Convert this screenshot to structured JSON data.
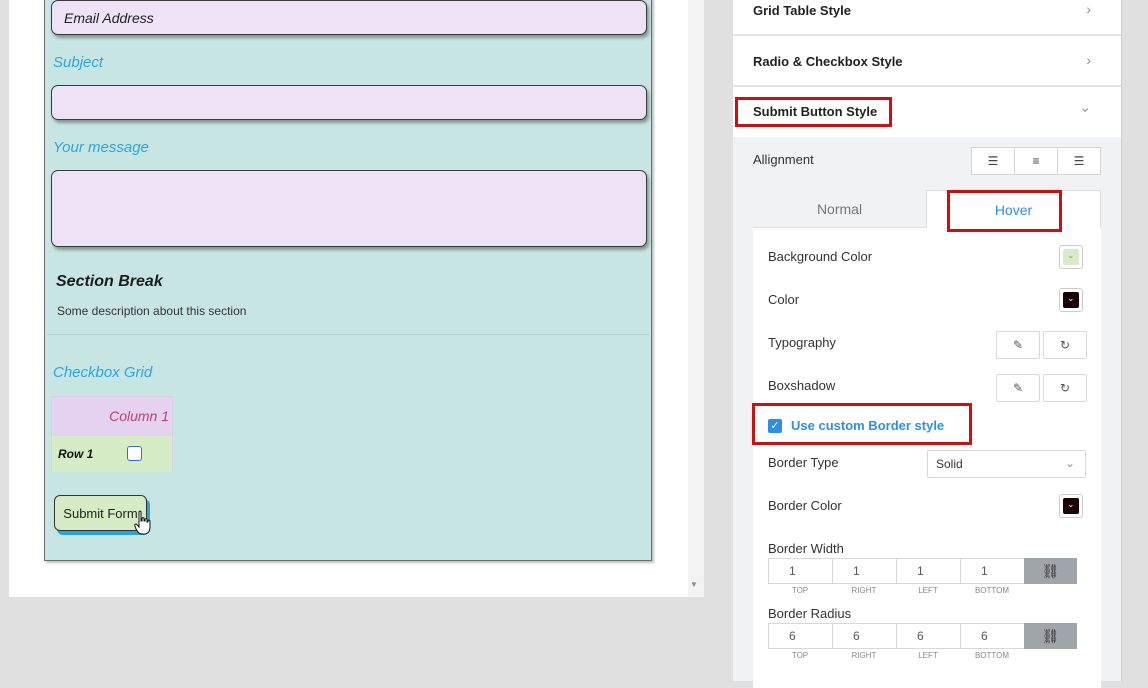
{
  "form": {
    "email_placeholder": "Email Address",
    "subject_label": "Subject",
    "message_label": "Your message",
    "section_title": "Section Break",
    "section_desc": "Some description about this section",
    "grid_label": "Checkbox Grid",
    "grid_column": "Column 1",
    "grid_row": "Row 1",
    "submit_label": "Submit Form"
  },
  "panel": {
    "sections": [
      {
        "label": "Grid Table Style"
      },
      {
        "label": "Radio & Checkbox Style"
      },
      {
        "label": "Submit Button Style"
      }
    ],
    "alignment_label": "Allignment",
    "tabs": [
      "Normal",
      "Hover"
    ],
    "active_tab": "Hover",
    "background_color_label": "Background Color",
    "background_color_value": "#d6ecc6",
    "color_label": "Color",
    "color_value": "#1a0206",
    "typography_label": "Typography",
    "boxshadow_label": "Boxshadow",
    "custom_border_label": "Use custom Border style",
    "custom_border_checked": true,
    "border_type_label": "Border Type",
    "border_type_value": "Solid",
    "border_color_label": "Border Color",
    "border_color_value": "#1a0206",
    "border_width_label": "Border Width",
    "border_width": [
      "1",
      "1",
      "1",
      "1"
    ],
    "border_radius_label": "Border Radius",
    "border_radius": [
      "6",
      "6",
      "6",
      "6"
    ],
    "dim_captions": [
      "TOP",
      "RIGHT",
      "LEFT",
      "BOTTOM"
    ]
  },
  "colors": {
    "accent": "#2d8fe6",
    "highlight_red": "#d10e0e",
    "form_bg": "#c7e6e3"
  },
  "icons": {
    "chevron": "chevron-right-icon",
    "chevron_open": "chevron-down-icon",
    "edit": "pencil-icon",
    "reset": "reset-icon",
    "unlink": "unlink-icon"
  }
}
